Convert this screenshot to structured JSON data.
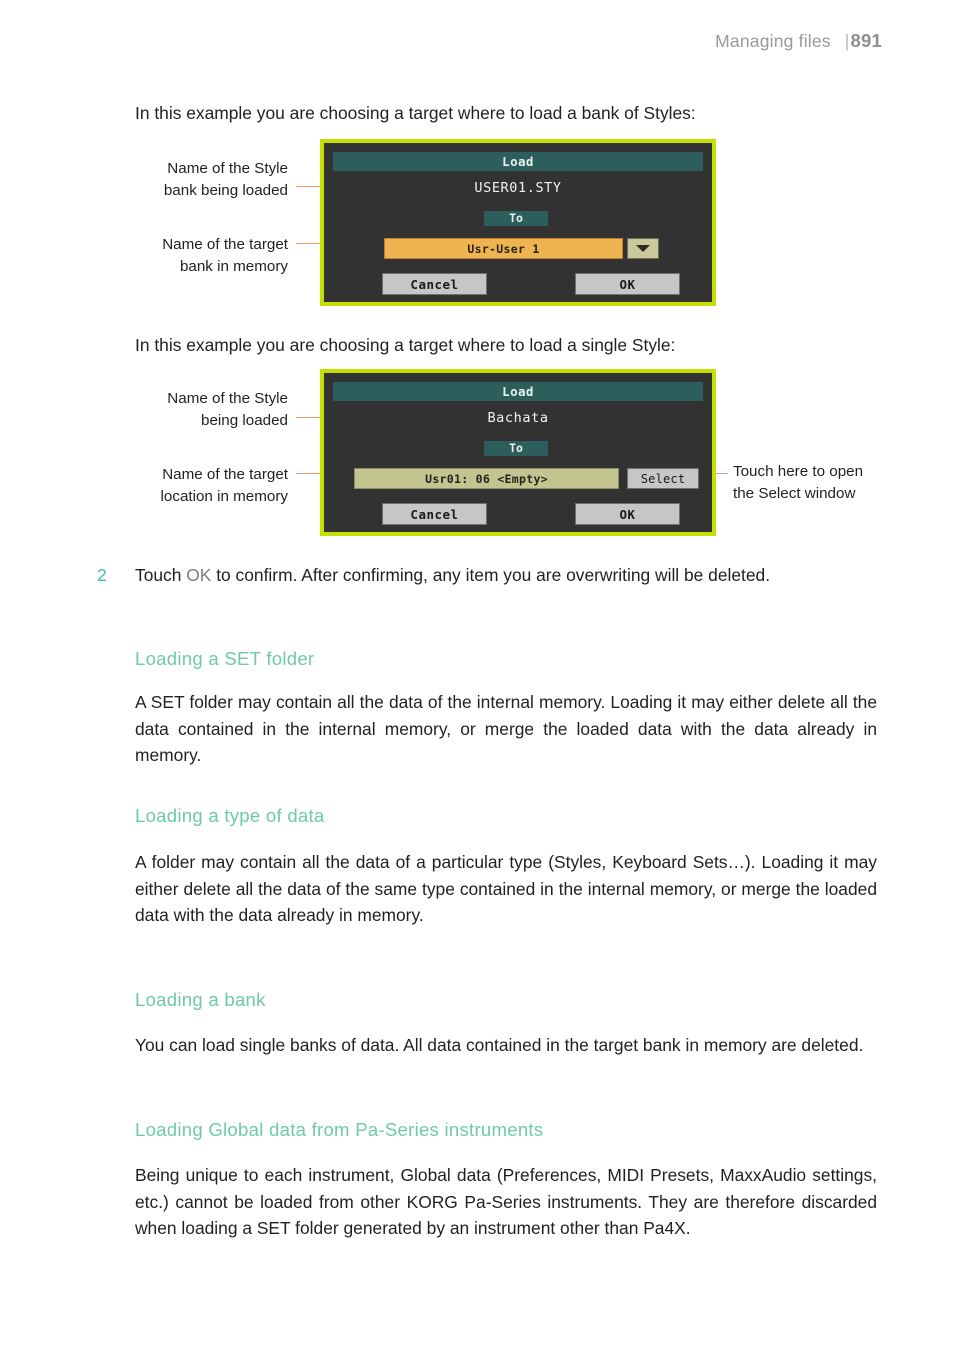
{
  "header": {
    "title": "Managing files",
    "rule": "|",
    "page_number": "891"
  },
  "intro_bank": "In this example you are choosing a target where to load a bank of Styles:",
  "intro_single": "In this example you are choosing a target where to load a single Style:",
  "figure_bank": {
    "callouts": {
      "style_bank_line1": "Name of the Style",
      "style_bank_line2": "bank being loaded",
      "target_bank_line1": "Name of the target",
      "target_bank_line2": "bank in memory"
    },
    "dialog": {
      "title": "Load",
      "filename": "USER01.STY",
      "to_label": "To",
      "target_value": "Usr-User 1",
      "dropdown_icon": "chevron-down-icon",
      "cancel_label": "Cancel",
      "ok_label": "OK"
    }
  },
  "figure_single": {
    "callouts": {
      "style_line1": "Name of the Style",
      "style_line2": "being loaded",
      "target_line1": "Name of the target",
      "target_line2": "location in memory",
      "select_hint_line1": "Touch here to open",
      "select_hint_line2": "the Select window"
    },
    "dialog": {
      "title": "Load",
      "filename": "Bachata",
      "to_label": "To",
      "target_value": "Usr01: 06 <Empty>",
      "select_label": "Select",
      "cancel_label": "Cancel",
      "ok_label": "OK"
    }
  },
  "step": {
    "number": "2",
    "text_before": "Touch ",
    "ui_ref": "OK",
    "text_after": " to confirm. After confirming, any item you are overwriting will be deleted."
  },
  "sections": [
    {
      "heading": "Loading a SET folder",
      "body": "A SET folder may contain all the data of the internal memory. Loading it may either delete all the data contained in the internal memory, or merge the loaded data with the data already in memory."
    },
    {
      "heading": "Loading a type of data",
      "body": "A folder may contain all the data of a particular type (Styles, Keyboard Sets…). Loading it may either delete all the data of the same type contained in the internal memory, or merge the loaded data with the data already in memory."
    },
    {
      "heading": "Loading a bank",
      "body": "You can load single banks of data. All data contained in the target bank in memory are deleted."
    },
    {
      "heading": "Loading Global data from Pa-Series instruments",
      "body": "Being unique to each instrument, Global data (Preferences, MIDI Presets, MaxxAudio settings, etc.) cannot be loaded from other KORG Pa-Series instruments. They are therefore discarded when loading a SET folder generated by an instrument other than Pa4X."
    }
  ],
  "colors": {
    "heading": "#6ec9ad",
    "step_number": "#3fbfa5",
    "dialog_border": "#c5e000",
    "dialog_bg": "#323232",
    "titlebar": "#2c5f5c",
    "field_orange": "#eeb44f",
    "field_khaki": "#c4c490",
    "leader_line": "#f2a16a"
  }
}
